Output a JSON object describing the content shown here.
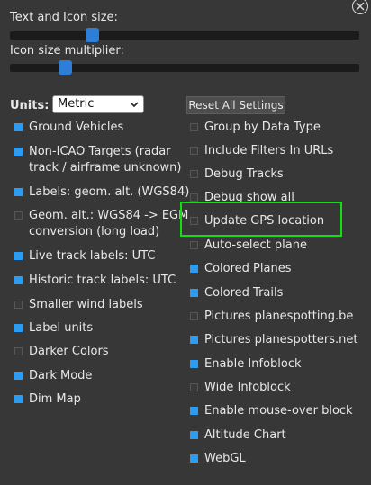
{
  "sliders": [
    {
      "label": "Text and Icon size:",
      "value_fraction": 0.18
    },
    {
      "label": "Icon size multiplier:",
      "value_fraction": 0.1
    }
  ],
  "units": {
    "label": "Units:",
    "selected": "Metric"
  },
  "reset_button": {
    "label": "Reset All Settings"
  },
  "left_options": [
    {
      "label": "Ground Vehicles",
      "checked": true
    },
    {
      "label": "Non-ICAO Targets (radar\ntrack / airframe unknown)",
      "checked": true
    },
    {
      "label": "Labels: geom. alt. (WGS84)",
      "checked": true
    },
    {
      "label": "Geom. alt.: WGS84 -> EGM\nconversion (long load)",
      "checked": false
    },
    {
      "label": "Live track labels: UTC",
      "checked": true
    },
    {
      "label": "Historic track labels: UTC",
      "checked": true
    },
    {
      "label": "Smaller wind labels",
      "checked": false
    },
    {
      "label": "Label units",
      "checked": true
    },
    {
      "label": "Darker Colors",
      "checked": false
    },
    {
      "label": "Dark Mode",
      "checked": true
    },
    {
      "label": "Dim Map",
      "checked": true
    }
  ],
  "right_options": [
    {
      "label": "Group by Data Type",
      "checked": false
    },
    {
      "label": "Include Filters In URLs",
      "checked": false
    },
    {
      "label": "Debug Tracks",
      "checked": false
    },
    {
      "label": "Debug show all",
      "checked": false
    },
    {
      "label": "Update GPS location",
      "checked": false
    },
    {
      "label": "Auto-select plane",
      "checked": false
    },
    {
      "label": "Colored Planes",
      "checked": true
    },
    {
      "label": "Colored Trails",
      "checked": true
    },
    {
      "label": "Pictures planespotting.be",
      "checked": false
    },
    {
      "label": "Pictures planespotters.net",
      "checked": true
    },
    {
      "label": "Enable Infoblock",
      "checked": true
    },
    {
      "label": "Wide Infoblock",
      "checked": false
    },
    {
      "label": "Enable mouse-over block",
      "checked": true
    },
    {
      "label": "Altitude Chart",
      "checked": true
    },
    {
      "label": "WebGL",
      "checked": true
    }
  ],
  "colors": {
    "accent": "#2b9cf2",
    "highlight": "#10e010",
    "background": "#373737"
  }
}
